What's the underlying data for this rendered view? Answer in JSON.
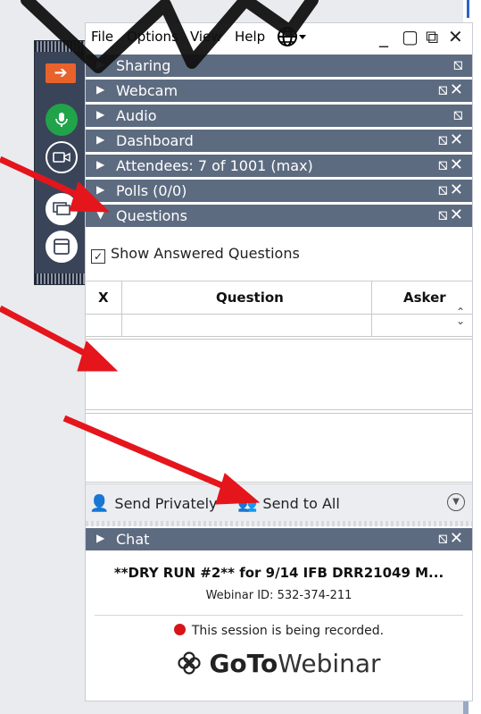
{
  "menu": {
    "file": "File",
    "options": "Options",
    "view": "View",
    "help": "Help"
  },
  "window_controls": {
    "minimize": "_",
    "restore": "▢",
    "popout": "⧉",
    "close": "✕"
  },
  "sections": {
    "sharing": "Sharing",
    "webcam": "Webcam",
    "audio": "Audio",
    "dashboard": "Dashboard",
    "attendees": "Attendees:  7 of 1001 (max)",
    "polls": "Polls (0/0)",
    "questions": "Questions",
    "chat": "Chat"
  },
  "questions": {
    "show_answered_label": "Show Answered Questions",
    "show_answered_checked": true,
    "columns": [
      "X",
      "Question",
      "Asker"
    ]
  },
  "send": {
    "privately": "Send Privately",
    "to_all": "Send to All"
  },
  "webinar": {
    "title": "**DRY RUN #2** for 9/14 IFB DRR21049 M...",
    "id_text": "Webinar ID: 532-374-211",
    "recording_text": "This session is being recorded.",
    "brand_goto": "GoTo",
    "brand_webinar": "Webinar"
  },
  "colors": {
    "header_bg": "#5d6b80",
    "arrow_red": "#e5151c",
    "record_red": "#d7141a",
    "mic_green": "#21a34a",
    "exit_orange": "#e8622c"
  }
}
